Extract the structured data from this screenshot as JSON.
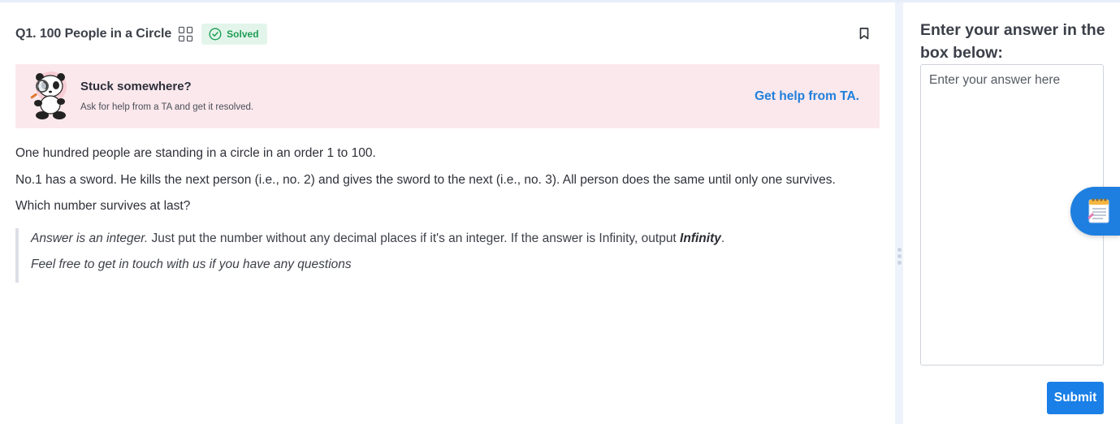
{
  "question": {
    "title": "Q1. 100 People in a Circle",
    "status": "Solved"
  },
  "help_banner": {
    "title": "Stuck somewhere?",
    "subtitle": "Ask for help from a TA and get it resolved.",
    "link": "Get help from TA."
  },
  "problem": {
    "paragraphs": [
      "One hundred people are standing in a circle in an order 1 to 100.",
      "No.1 has a sword. He kills the next person (i.e., no. 2) and gives the sword to the next (i.e., no. 3). All person does the same until only one survives.",
      "Which number survives at last?"
    ],
    "note": {
      "lead": "Answer is an integer.",
      "middle": " Just put the number without any decimal places if it's an integer. If the answer is Infinity, output ",
      "emphasis": "Infinity",
      "end": ".",
      "line2": "Feel free to get in touch with us if you have any questions"
    }
  },
  "answer_panel": {
    "heading": "Enter your answer in the box below:",
    "placeholder": "Enter your answer here",
    "submit_label": "Submit"
  },
  "colors": {
    "accent": "#1a7fe6",
    "banner_bg": "#fbe8ec",
    "solved_bg": "#e3f5ea",
    "solved_text": "#1f9d55"
  },
  "icons": [
    "grid-icon",
    "check-circle-icon",
    "bookmark-icon",
    "panda-mascot-icon",
    "notes-icon",
    "drag-handle-icon"
  ]
}
